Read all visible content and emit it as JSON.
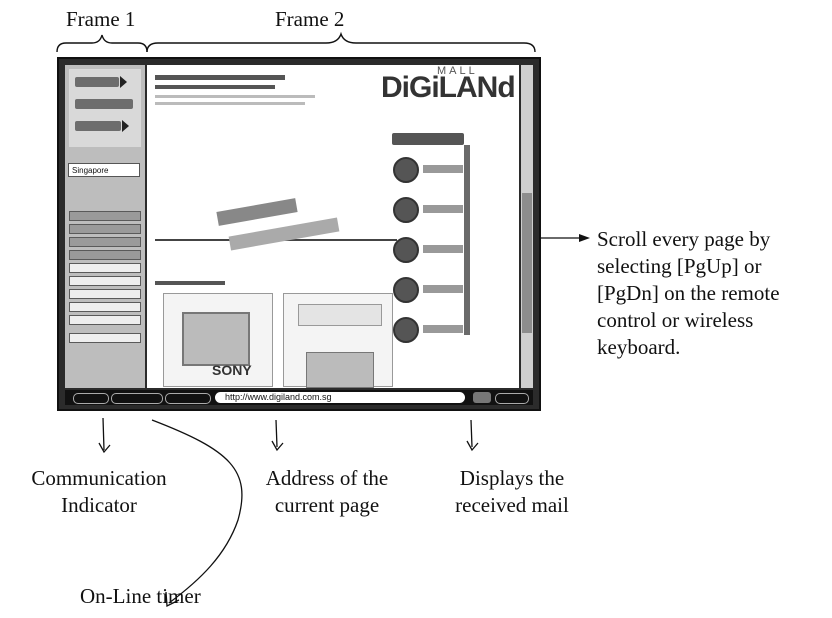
{
  "labels": {
    "frame1": "Frame 1",
    "frame2": "Frame 2",
    "scroll": [
      "Scroll every page by",
      "selecting [PgUp] or",
      "[PgDn] on the remote",
      "control or wireless",
      "keyboard."
    ],
    "comm_indicator": [
      "Communication",
      "Indicator"
    ],
    "address_of_page": [
      "Address of the",
      "current page"
    ],
    "received_mail": [
      "Displays the",
      "received mail"
    ],
    "online_timer": "On-Line timer"
  },
  "screenshot": {
    "address_url": "http://www.digiland.com.sg",
    "logo_main": "DiGiLANd",
    "logo_mall": "MALL",
    "region_select": "Singapore",
    "tile_brand": "SONY"
  }
}
